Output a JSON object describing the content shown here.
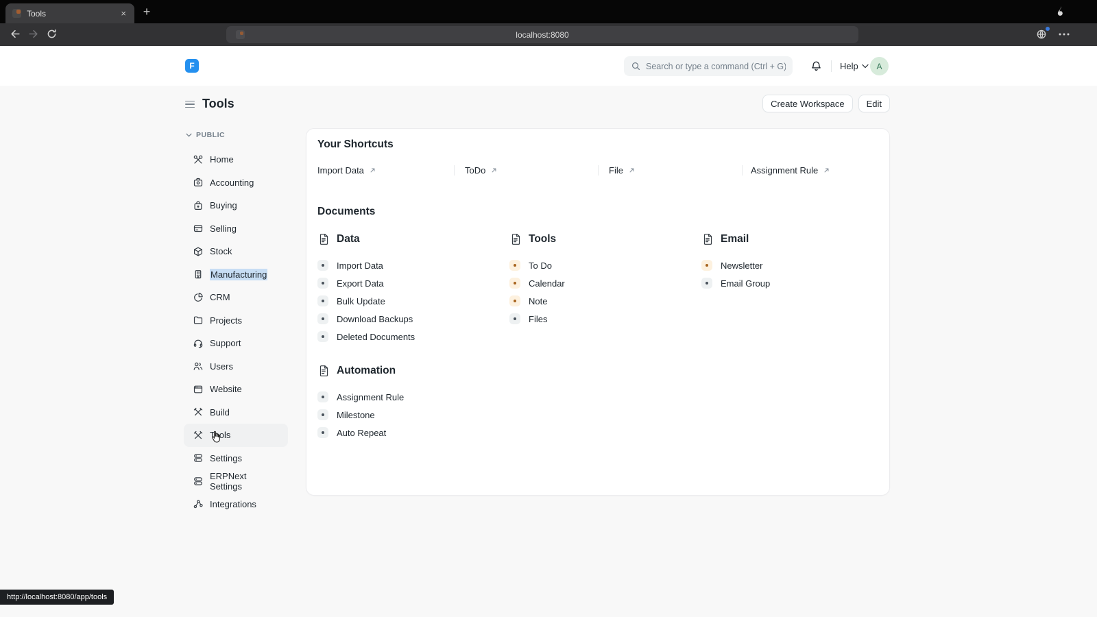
{
  "browser": {
    "tab_title": "Tools",
    "close_icon": "×",
    "new_tab_icon": "+",
    "url": "localhost:8080",
    "status_url": "http://localhost:8080/app/tools"
  },
  "app_header": {
    "logo_letter": "F",
    "search_placeholder": "Search or type a command (Ctrl + G)",
    "help_label": "Help",
    "avatar_initial": "A"
  },
  "page_header": {
    "title": "Tools",
    "create_workspace_label": "Create Workspace",
    "edit_label": "Edit"
  },
  "sidebar": {
    "section_label": "PUBLIC",
    "items": [
      {
        "label": "Home",
        "icon": "wrench-icon"
      },
      {
        "label": "Accounting",
        "icon": "briefcase-icon"
      },
      {
        "label": "Buying",
        "icon": "shopping-bag-icon"
      },
      {
        "label": "Selling",
        "icon": "credit-card-icon"
      },
      {
        "label": "Stock",
        "icon": "package-icon"
      },
      {
        "label": "Manufacturing",
        "icon": "factory-icon",
        "text_highlighted": true
      },
      {
        "label": "CRM",
        "icon": "pie-chart-icon"
      },
      {
        "label": "Projects",
        "icon": "folder-icon"
      },
      {
        "label": "Support",
        "icon": "headset-icon"
      },
      {
        "label": "Users",
        "icon": "users-icon"
      },
      {
        "label": "Website",
        "icon": "browser-window-icon"
      },
      {
        "label": "Build",
        "icon": "hammer-icon"
      },
      {
        "label": "Tools",
        "icon": "hammer-icon",
        "selected": true
      },
      {
        "label": "Settings",
        "icon": "sliders-icon"
      },
      {
        "label": "ERPNext Settings",
        "icon": "server-icon"
      },
      {
        "label": "Integrations",
        "icon": "share-icon"
      }
    ]
  },
  "shortcuts": {
    "title": "Your Shortcuts",
    "items": [
      {
        "label": "Import Data"
      },
      {
        "label": "ToDo"
      },
      {
        "label": "File"
      },
      {
        "label": "Assignment Rule"
      }
    ]
  },
  "documents": {
    "title": "Documents",
    "sections": [
      {
        "title": "Data",
        "links": [
          {
            "label": "Import Data",
            "tone": "gray"
          },
          {
            "label": "Export Data",
            "tone": "gray"
          },
          {
            "label": "Bulk Update",
            "tone": "gray"
          },
          {
            "label": "Download Backups",
            "tone": "gray"
          },
          {
            "label": "Deleted Documents",
            "tone": "gray"
          }
        ]
      },
      {
        "title": "Tools",
        "links": [
          {
            "label": "To Do",
            "tone": "amber"
          },
          {
            "label": "Calendar",
            "tone": "amber"
          },
          {
            "label": "Note",
            "tone": "amber"
          },
          {
            "label": "Files",
            "tone": "gray"
          }
        ]
      },
      {
        "title": "Email",
        "links": [
          {
            "label": "Newsletter",
            "tone": "amber"
          },
          {
            "label": "Email Group",
            "tone": "gray"
          }
        ]
      },
      {
        "title": "Automation",
        "links": [
          {
            "label": "Assignment Rule",
            "tone": "gray"
          },
          {
            "label": "Milestone",
            "tone": "gray"
          },
          {
            "label": "Auto Repeat",
            "tone": "gray"
          }
        ]
      }
    ]
  },
  "colors": {
    "accent_blue": "#2490ef",
    "avatar_bg": "#d7ebdb",
    "avatar_text": "#38795b",
    "amber_bullet_bg": "#fdf1df",
    "amber_bullet_dot": "#a8641e",
    "gray_bullet_bg": "#eef1f2",
    "gray_bullet_dot": "#49525b",
    "text_selection_highlight": "#c7ddf4"
  }
}
